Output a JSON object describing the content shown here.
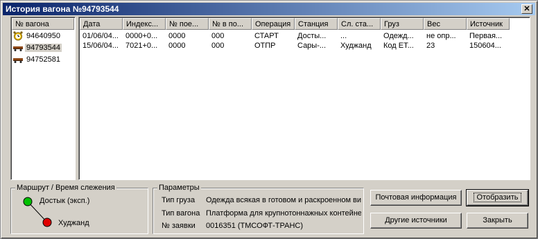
{
  "window": {
    "title": "История вагона №94793544",
    "close_glyph": "✕"
  },
  "wagon_list": {
    "header": "№ вагона",
    "items": [
      {
        "number": "94640950",
        "icon": "alarm-clock-icon",
        "selected": false
      },
      {
        "number": "94793544",
        "icon": "railcar-icon",
        "selected": true
      },
      {
        "number": "94752581",
        "icon": "railcar-icon",
        "selected": false
      }
    ]
  },
  "grid": {
    "columns": [
      "Дата",
      "Индекс...",
      "№ пое...",
      "№ в по...",
      "Операция",
      "Станция",
      "Сл. ста...",
      "Груз",
      "Вес",
      "Источник"
    ],
    "rows": [
      [
        "01/06/04...",
        "0000+0...",
        "0000",
        "000",
        "СТАРТ",
        "Досты...",
        "...",
        "Одежд...",
        "не опр...",
        "Первая..."
      ],
      [
        "15/06/04...",
        "7021+0...",
        "0000",
        "000",
        "ОТПР",
        "Сары-...",
        "Худжанд",
        "Код ЕТ...",
        "23",
        "150604..."
      ]
    ]
  },
  "route": {
    "legend": "Маршрут / Время слежения",
    "start_label": "Достык (эксп.)",
    "end_label": "Худжанд",
    "start_color": "#00c000",
    "end_color": "#e00000"
  },
  "params": {
    "legend": "Параметры",
    "cargo_type_label": "Тип груза",
    "cargo_type_value": "Одежда всякая в готовом и раскроенном ви",
    "wagon_type_label": "Тип вагона",
    "wagon_type_value": "Платформа для крупнотоннажных контейне",
    "request_label": "№ заявки",
    "request_value": "0016351 (ТМСОФТ-ТРАНС)"
  },
  "buttons": {
    "mail_info": "Почтовая информация",
    "display": "Отобразить",
    "other_sources": "Другие источники",
    "close": "Закрыть"
  }
}
